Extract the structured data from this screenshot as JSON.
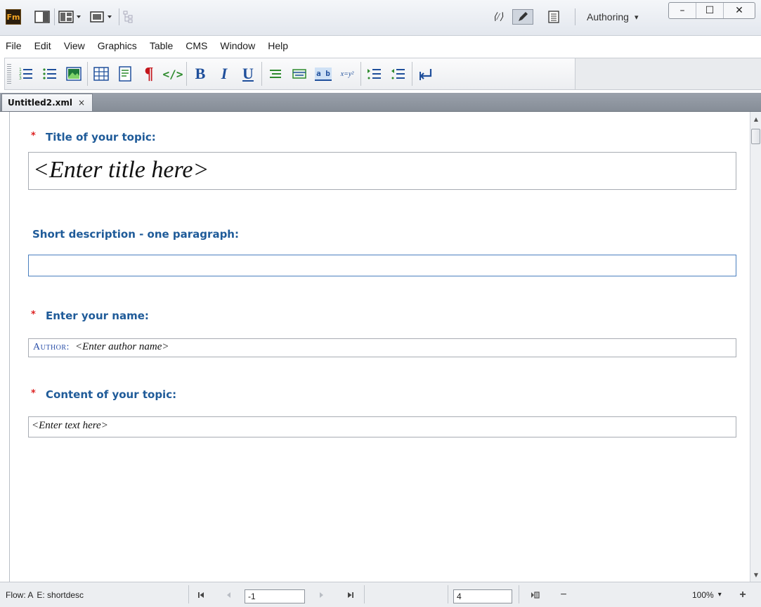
{
  "app": {
    "logo_text": "Fm",
    "view_mode": "Authoring",
    "view_mode_caret": "▾",
    "window_buttons": {
      "minimize": "–",
      "maximize": "☐",
      "close": "✕"
    }
  },
  "menu": [
    "File",
    "Edit",
    "View",
    "Graphics",
    "Table",
    "CMS",
    "Window",
    "Help"
  ],
  "toolbar": {
    "icons": [
      "numbered-list-icon",
      "bullet-list-icon",
      "insert-image-icon",
      "insert-table-icon",
      "note-icon",
      "paragraph-icon",
      "code-icon",
      "bold-icon",
      "italic-icon",
      "underline-icon",
      "align-icon",
      "text-box-icon",
      "ab-icon",
      "equation-icon",
      "indent-icon",
      "outdent-icon",
      "line-break-icon"
    ],
    "bold": "B",
    "italic": "I",
    "underline": "U",
    "pilcrow": "¶",
    "code": "</>",
    "ab": "a b",
    "equation": "x=y²"
  },
  "tab": {
    "label": "Untitled2.xml",
    "close": "×"
  },
  "document": {
    "required_marker": "*",
    "title_label": "Title of your topic:",
    "title_placeholder": "<Enter title here>",
    "shortdesc_label": "Short description - one paragraph:",
    "shortdesc_value": "",
    "name_label": "Enter your name:",
    "author_label": "Author:",
    "author_placeholder": "<Enter author name>",
    "content_label": "Content of your topic:",
    "content_placeholder": "<Enter text here>"
  },
  "status": {
    "flow": "Flow: A",
    "element": "E: shortdesc",
    "page_input": "-1",
    "page_count": "4",
    "zoom": "100%",
    "zoom_caret": "▾",
    "zoom_out": "−",
    "zoom_in": "+"
  }
}
